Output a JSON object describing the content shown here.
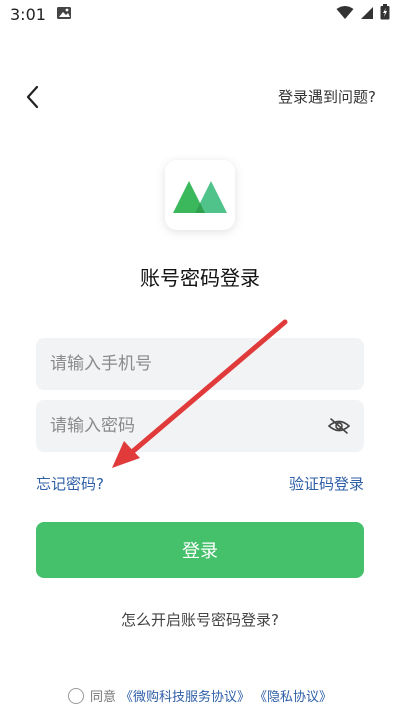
{
  "status_bar": {
    "time": "3:01"
  },
  "header": {
    "help_link": "登录遇到问题?"
  },
  "page": {
    "title": "账号密码登录"
  },
  "form": {
    "phone_placeholder": "请输入手机号",
    "password_placeholder": "请输入密码",
    "forgot_password": "忘记密码?",
    "code_login": "验证码登录",
    "login_button": "登录"
  },
  "how_to_enable": "怎么开启账号密码登录?",
  "agreement": {
    "prefix": "同意",
    "service_link": "《微购科技服务协议》",
    "privacy_link": "《隐私协议》"
  },
  "colors": {
    "primary_green": "#45c06b",
    "link_blue": "#2f5fa7",
    "annotation_red": "#e03a3a"
  },
  "icons": {
    "back": "chevron-left-icon",
    "eye": "eye-off-icon",
    "logo": "mountain-logo-icon"
  }
}
